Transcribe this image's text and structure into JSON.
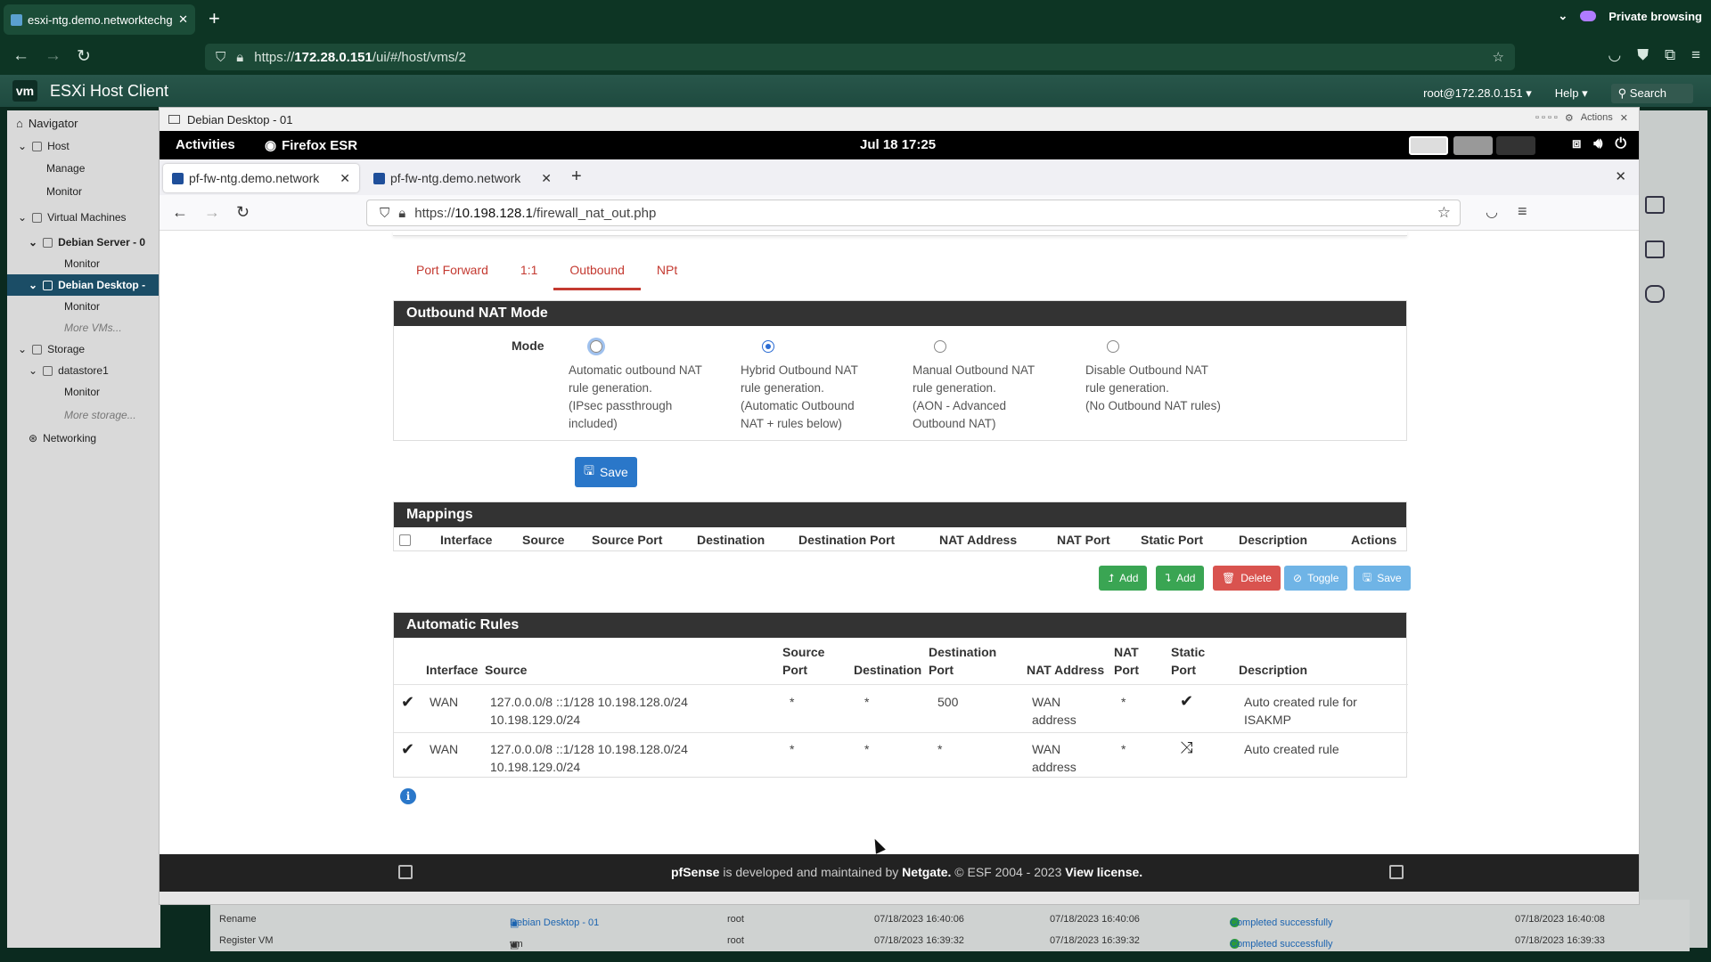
{
  "outer_browser": {
    "tab_title": "esxi-ntg.demo.networktechguy",
    "url_prefix": "https://",
    "url_host": "172.28.0.151",
    "url_path": "/ui/#/host/vms/2",
    "private_label": "Private browsing"
  },
  "esxi": {
    "logo": "vm",
    "title": "ESXi Host Client",
    "user": "root@172.28.0.151 ▾",
    "help": "Help ▾",
    "search": "Search",
    "navigator": {
      "header": "Navigator",
      "items": [
        {
          "label": "Host"
        },
        {
          "label": "Manage"
        },
        {
          "label": "Monitor"
        },
        {
          "label": "Virtual Machines"
        },
        {
          "label": "Debian Server - 0"
        },
        {
          "label": "Monitor"
        },
        {
          "label": "Debian Desktop -"
        },
        {
          "label": "Monitor"
        },
        {
          "label": "More VMs..."
        },
        {
          "label": "Storage"
        },
        {
          "label": "datastore1"
        },
        {
          "label": "Monitor"
        },
        {
          "label": "More storage..."
        },
        {
          "label": "Networking"
        }
      ]
    },
    "tasks": [
      {
        "task": "Rename",
        "target": "Debian Desktop - 01",
        "initiator": "root",
        "queued": "07/18/2023 16:40:06",
        "started": "07/18/2023 16:40:06",
        "result": "Completed successfully",
        "completed": "07/18/2023 16:40:08"
      },
      {
        "task": "Register VM",
        "target": "vm",
        "initiator": "root",
        "queued": "07/18/2023 16:39:32",
        "started": "07/18/2023 16:39:32",
        "result": "Completed successfully",
        "completed": "07/18/2023 16:39:33"
      }
    ]
  },
  "vm_window": {
    "title": "Debian Desktop - 01",
    "actions": "Actions"
  },
  "gnome": {
    "activities": "Activities",
    "app": "Firefox ESR",
    "clock": "Jul 18  17:25"
  },
  "inner_browser": {
    "tabs": [
      {
        "title": "pf-fw-ntg.demo.network"
      },
      {
        "title": "pf-fw-ntg.demo.network"
      }
    ],
    "url_prefix": "https://",
    "url_host": "10.198.128.1",
    "url_path": "/firewall_nat_out.php"
  },
  "pfsense": {
    "subtabs": [
      "Port Forward",
      "1:1",
      "Outbound",
      "NPt"
    ],
    "mode_panel": {
      "header": "Outbound NAT Mode",
      "label": "Mode",
      "options": [
        {
          "l1": "Automatic outbound NAT",
          "l2": "rule generation.",
          "l3": "(IPsec passthrough",
          "l4": "included)"
        },
        {
          "l1": "Hybrid Outbound NAT",
          "l2": "rule generation.",
          "l3": "(Automatic Outbound",
          "l4": "NAT + rules below)"
        },
        {
          "l1": "Manual Outbound NAT",
          "l2": "rule generation.",
          "l3": "(AON - Advanced",
          "l4": "Outbound NAT)"
        },
        {
          "l1": "Disable Outbound NAT",
          "l2": "rule generation.",
          "l3": "(No Outbound NAT rules)",
          "l4": ""
        }
      ],
      "save": "Save"
    },
    "mappings": {
      "header": "Mappings",
      "columns": [
        "Interface",
        "Source",
        "Source Port",
        "Destination",
        "Destination Port",
        "NAT Address",
        "NAT Port",
        "Static Port",
        "Description",
        "Actions"
      ],
      "buttons": {
        "add_top": "Add",
        "add_bottom": "Add",
        "delete": "Delete",
        "toggle": "Toggle",
        "save": "Save"
      }
    },
    "auto_rules": {
      "header": "Automatic Rules",
      "columns": {
        "interface": "Interface",
        "source": "Source",
        "source_port_1": "Source",
        "source_port_2": "Port",
        "destination": "Destination",
        "dest_port_1": "Destination",
        "dest_port_2": "Port",
        "nat_address": "NAT Address",
        "nat_port_1": "NAT",
        "nat_port_2": "Port",
        "static_port_1": "Static",
        "static_port_2": "Port",
        "description": "Description"
      },
      "rows": [
        {
          "interface": "WAN",
          "source_1": "127.0.0.0/8 ::1/128 10.198.128.0/24",
          "source_2": "10.198.129.0/24",
          "source_port": "*",
          "destination": "*",
          "dest_port": "500",
          "nat_1": "WAN",
          "nat_2": "address",
          "nat_port": "*",
          "static": "✔",
          "desc_1": "Auto created rule for",
          "desc_2": "ISAKMP"
        },
        {
          "interface": "WAN",
          "source_1": "127.0.0.0/8 ::1/128 10.198.128.0/24",
          "source_2": "10.198.129.0/24",
          "source_port": "*",
          "destination": "*",
          "dest_port": "*",
          "nat_1": "WAN",
          "nat_2": "address",
          "nat_port": "*",
          "static": "⤨",
          "desc_1": "Auto created rule",
          "desc_2": ""
        }
      ]
    },
    "footer": {
      "brand": "pfSense",
      "mid": " is developed and maintained by ",
      "company": "Netgate.",
      "copy": " © ESF 2004 - 2023 ",
      "license": "View license."
    }
  }
}
